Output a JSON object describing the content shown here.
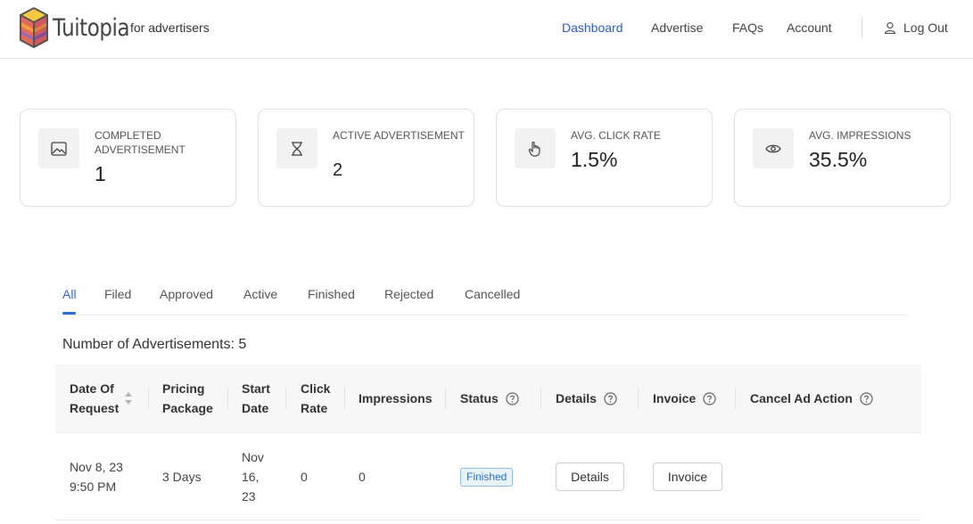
{
  "header": {
    "brand": "Tuitopia",
    "brand_sub": "for advertisers",
    "nav": [
      "Dashboard",
      "Advertise",
      "FAQs",
      "Account"
    ],
    "active_nav": "Dashboard",
    "logout": "Log Out"
  },
  "stats": [
    {
      "label": "COMPLETED ADVERTISEMENT",
      "value": "1",
      "icon": "image-icon"
    },
    {
      "label": "ACTIVE ADVERTISEMENT",
      "value": "2",
      "icon": "hourglass-icon"
    },
    {
      "label": "AVG. CLICK RATE",
      "value": "1.5%",
      "icon": "pointer-hand-icon"
    },
    {
      "label": "AVG. IMPRESSIONS",
      "value": "35.5%",
      "icon": "eye-icon"
    }
  ],
  "tabs": [
    "All",
    "Filed",
    "Approved",
    "Active",
    "Finished",
    "Rejected",
    "Cancelled"
  ],
  "active_tab": "All",
  "count_text": "Number of Advertisements: 5",
  "table": {
    "headers": {
      "date_l1": "Date Of",
      "date_l2": "Request",
      "pkg_l1": "Pricing",
      "pkg_l2": "Package",
      "start_l1": "Start",
      "start_l2": "Date",
      "click_l1": "Click",
      "click_l2": "Rate",
      "impressions": "Impressions",
      "status": "Status",
      "details": "Details",
      "invoice": "Invoice",
      "cancel": "Cancel Ad Action"
    },
    "rows": [
      {
        "date_l1": "Nov 8, 23",
        "date_l2": "9:50 PM",
        "package": "3 Days",
        "start_l1": "Nov",
        "start_l2": "16,",
        "start_l3": "23",
        "click_rate": "0",
        "impressions": "0",
        "status": "Finished",
        "details_btn": "Details",
        "invoice_btn": "Invoice"
      }
    ]
  },
  "colors": {
    "accent": "#2a6dd6",
    "nav_active": "#2a5ccf",
    "status_finished_bg": "#e9f3fd",
    "status_finished_border": "#8fbce8"
  }
}
